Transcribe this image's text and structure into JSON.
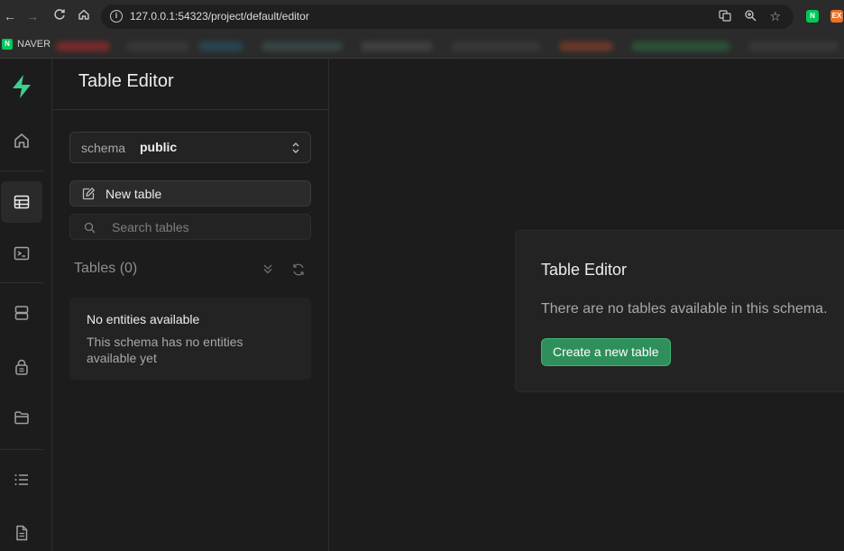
{
  "browser": {
    "url": "127.0.0.1:54323/project/default/editor",
    "bookmark_naver": "NAVER",
    "ext_naver": "N",
    "ext_other": "EX"
  },
  "rail": {
    "items": [
      {
        "name": "home-icon",
        "active": false
      },
      {
        "name": "table-editor-icon",
        "active": true
      },
      {
        "name": "sql-editor-icon",
        "active": false
      },
      {
        "name": "database-icon",
        "active": false
      },
      {
        "name": "auth-icon",
        "active": false
      },
      {
        "name": "storage-icon",
        "active": false
      },
      {
        "name": "logs-icon",
        "active": false
      },
      {
        "name": "docs-icon",
        "active": false
      }
    ]
  },
  "sidebar": {
    "title": "Table Editor",
    "schema_label": "schema",
    "schema_value": "public",
    "new_table_label": "New table",
    "search_placeholder": "Search tables",
    "tables_heading": "Tables (0)",
    "empty_title": "No entities available",
    "empty_desc": "This schema has no entities available yet"
  },
  "main": {
    "card_title": "Table Editor",
    "card_desc": "There are no tables available in this schema.",
    "create_button": "Create a new table"
  },
  "colors": {
    "accent": "#3ecf8e",
    "button_bg": "#2f8f5b",
    "background": "#1c1c1c"
  }
}
